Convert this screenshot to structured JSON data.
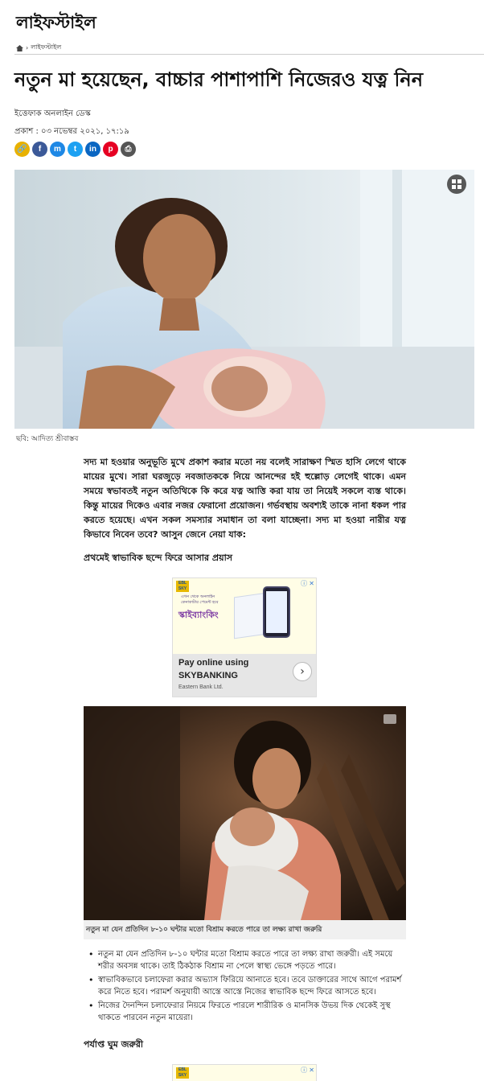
{
  "section": {
    "title": "লাইফস্টাইল"
  },
  "breadcrumb": {
    "home_icon": "home-icon",
    "separator": "›",
    "current": "লাইফস্টাইল"
  },
  "article": {
    "headline": "নতুন মা হয়েছেন, বাচ্চার পাশাপাশি নিজেরও যত্ন নিন",
    "author": "ইত্তেফাক অনলাইন ডেস্ক",
    "published": "প্রকাশ : ০৩ নভেম্বর ২০২১, ১৭:১৯",
    "hero_caption": "ছবি: আদিত্য শ্রীবাস্তব",
    "intro": "সদ্য মা হওয়ার অনুভূতি মুখে প্রকাশ করার মতো নয় বলেই সারাক্ষণ স্মিত হাসি লেগে থাকে মায়ের মুখে। সারা ঘরজুড়ে নবজাতককে নিয়ে আনন্দের হই হুল্লোড় লেগেই থাকে। এমন সময়ে স্বভাবতই নতুন অতিথিকে কি করে যত্ন আত্তি করা যায় তা নিয়েই সকলে ব্যস্ত থাকে। কিন্তু মায়ের দিকেও এবার নজর ফেরানো প্রয়োজন। গর্ভবস্থায় অবশ্যই তাকে নানা ধকল পার করতে হয়েছে। এখন সকল সমস্যার সমাধান তা বলা যাচ্ছেনা। সদ্য মা হওয়া নারীর যত্ন কিভাবে নিবেন তবে? আসুন জেনে নেয়া যাক:",
    "subheading_1": "প্রথমেই স্বাভাবিক ছন্দে ফিরে আসার প্রয়াস",
    "photo2_caption": "নতুন মা যেন প্রতিদিন ৮-১০ ঘন্টার মতো বিশ্রাম করতে পারে তা লক্ষ্য রাখা জরুরি",
    "bullets": [
      "নতুন মা যেন প্রতিদিন ৮-১০ ঘন্টার মতো বিশ্রাম করতে পারে তা লক্ষ্য রাখা জরুরী। এই সময়ে শরীর অবসন্ন থাকে। তাই ঠিকঠাক বিশ্রাম না পেলে স্বাস্থ্য ভেঙ্গে পড়তে পারে।",
      "স্বাভাবিকভাবে চলাফেরা করার অভ্যাস ফিরিয়ে আনাতে হবে। তবে ডাক্তারের সাথে আগে পরামর্শ করে নিতে হবে। পরামর্শ অনুযায়ী আস্তে আস্তে নিজের স্বাভাবিক ছন্দে ফিরে আসতে হবে।",
      "নিজের দৈনন্দিন চলাফেরার নিয়মে ফিরতে পারলে শারীরিক ও মানসিক উভয় দিক থেকেই সুস্থ থাকতে পারবেন নতুন মায়েরা।"
    ],
    "subheading_2": "পর্যাপ্ত ঘুম জরুরী"
  },
  "share": {
    "icons": [
      {
        "name": "copy-link-icon",
        "glyph": "🔗",
        "color": "#e8b100"
      },
      {
        "name": "facebook-icon",
        "glyph": "f",
        "color": "#3b5998"
      },
      {
        "name": "messenger-icon",
        "glyph": "m",
        "color": "#1e88e5"
      },
      {
        "name": "twitter-icon",
        "glyph": "t",
        "color": "#1da1f2"
      },
      {
        "name": "linkedin-icon",
        "glyph": "in",
        "color": "#0a66c2"
      },
      {
        "name": "pinterest-icon",
        "glyph": "p",
        "color": "#e60023"
      },
      {
        "name": "print-icon",
        "glyph": "⎙",
        "color": "#555555"
      }
    ]
  },
  "ad": {
    "close": "ⓘ ✕",
    "brand_logo": "EBL SKY",
    "teaser": "এখন থেকে অনলাইন কেনাকাটার পেমেন্ট হবে",
    "product": "স্কাইব্যাংকিং",
    "line1": "Pay online using",
    "line2": "SKYBANKING",
    "advertiser": "Eastern Bank Ltd.",
    "arrow": "›"
  },
  "colors": {
    "accent": "#3b5998",
    "ad_purple": "#7c3aa3"
  }
}
